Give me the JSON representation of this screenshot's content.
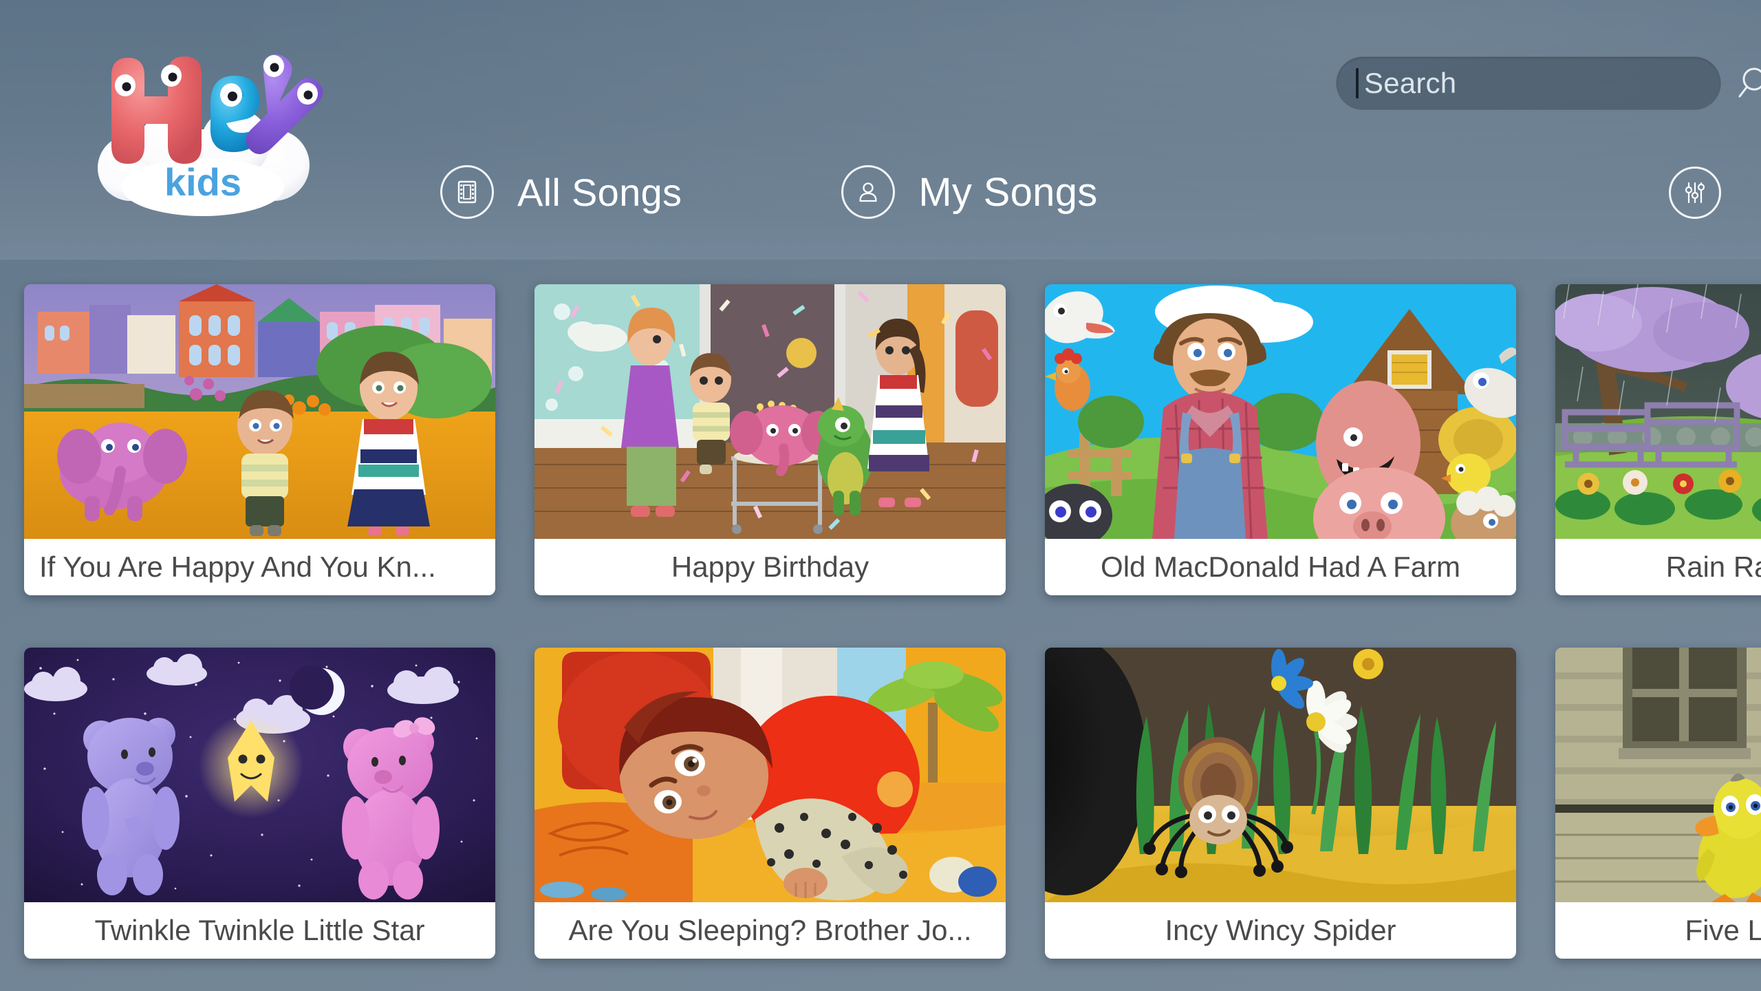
{
  "app": {
    "name": "Hey Kids",
    "logo_word": "Hey",
    "logo_subword": "kids",
    "background_color": "#6b7f91"
  },
  "header": {
    "search": {
      "placeholder": "Search",
      "value": "",
      "icon": "search-icon",
      "has_cursor": true
    },
    "tabs": [
      {
        "label": "All Songs",
        "icon": "film-strip-icon",
        "selected": true
      },
      {
        "label": "My Songs",
        "icon": "user-person-icon",
        "selected": false
      }
    ],
    "settings": {
      "icon": "sliders-settings-icon",
      "label": "Settings"
    }
  },
  "songs": [
    {
      "title": "If You Are Happy And You Kn...",
      "full_title": "If You Are Happy And You Know It",
      "truncated": true,
      "align": "left",
      "thumb": "park-elephant-kids"
    },
    {
      "title": "Happy Birthday",
      "full_title": "Happy Birthday",
      "truncated": false,
      "align": "center",
      "thumb": "birthday-party-cake"
    },
    {
      "title": "Old MacDonald Had A Farm",
      "full_title": "Old MacDonald Had A Farm",
      "truncated": false,
      "align": "center",
      "thumb": "farmer-barn-animals"
    },
    {
      "title": "Rain Rain Go Away",
      "full_title": "Rain Rain Go Away",
      "truncated": false,
      "align": "center",
      "thumb": "rainy-park-umbrella"
    },
    {
      "title": "Twinkle Twinkle Little Star",
      "full_title": "Twinkle Twinkle Little Star",
      "truncated": false,
      "align": "center",
      "thumb": "night-bears-star"
    },
    {
      "title": "Are You Sleeping? Brother Jo...",
      "full_title": "Are You Sleeping? Brother John",
      "truncated": true,
      "align": "center",
      "thumb": "sleeping-child-bed"
    },
    {
      "title": "Incy Wincy Spider",
      "full_title": "Incy Wincy Spider",
      "truncated": false,
      "align": "center",
      "thumb": "spider-grass-daisy"
    },
    {
      "title": "Five Little Ducks",
      "full_title": "Five Little Ducks",
      "truncated": false,
      "align": "center",
      "thumb": "ducklings-porch"
    }
  ]
}
